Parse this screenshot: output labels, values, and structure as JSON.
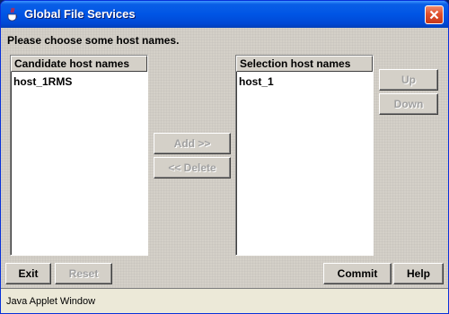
{
  "window": {
    "title": "Global File Services",
    "icon": "java-cup-icon",
    "close_icon": "close-icon"
  },
  "prompt": "Please choose some host names.",
  "candidate": {
    "header": "Candidate host names",
    "items": [
      "host_1RMS"
    ]
  },
  "selection": {
    "header": "Selection host names",
    "items": [
      "host_1"
    ]
  },
  "buttons": {
    "add": "Add >>",
    "delete": "<< Delete",
    "up": "Up",
    "down": "Down",
    "exit": "Exit",
    "reset": "Reset",
    "commit": "Commit",
    "help": "Help"
  },
  "status": "Java Applet Window",
  "colors": {
    "titlebar": "#0055e5",
    "face": "#d4d0c8",
    "close": "#e0502c"
  }
}
